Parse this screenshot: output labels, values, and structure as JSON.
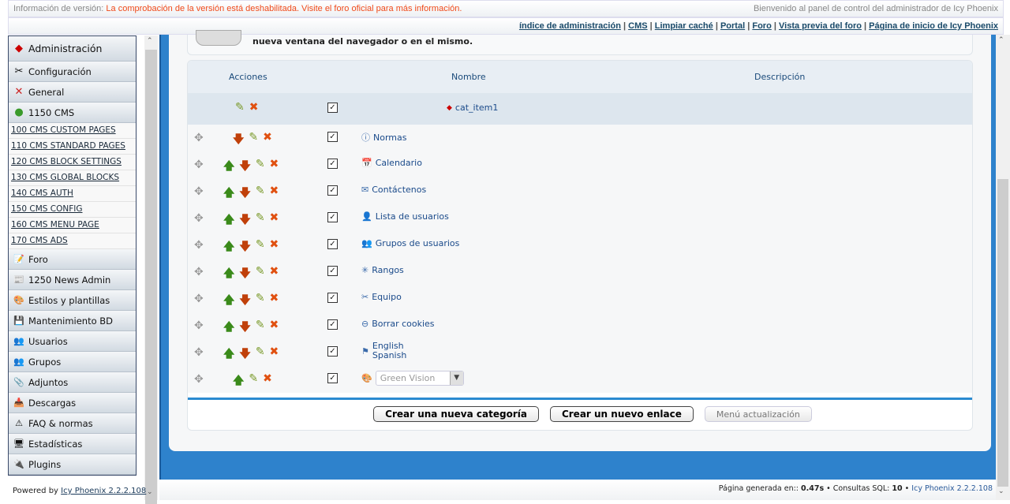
{
  "topbar": {
    "label": "Información de versión:",
    "warning": "La comprobación de la versión está deshabilitada. Visite el foro oficial para más información.",
    "welcome": "Bienvenido al panel de control del administrador de Icy Phoenix"
  },
  "links": [
    "índice de administración",
    "CMS",
    "Limpiar caché",
    "Portal",
    "Foro",
    "Vista previa del foro",
    "Página de inicio de Icy Phoenix"
  ],
  "sidebar": {
    "heads_top": [
      {
        "label": "Administración",
        "icon": "diamond-icon"
      },
      {
        "label": "Configuración",
        "icon": "tools-icon"
      },
      {
        "label": "General",
        "icon": "wrench-icon"
      },
      {
        "label": "1150 CMS",
        "icon": "blocks-icon"
      }
    ],
    "cms_links": [
      "100 CMS CUSTOM PAGES",
      "110 CMS STANDARD PAGES",
      "120 CMS BLOCK SETTINGS",
      "130 CMS GLOBAL BLOCKS",
      "140 CMS AUTH",
      "150 CMS CONFIG",
      "160 CMS MENU PAGE",
      "170 CMS ADS"
    ],
    "heads_bottom": [
      {
        "label": "Foro"
      },
      {
        "label": "1250 News Admin"
      },
      {
        "label": "Estilos y plantillas"
      },
      {
        "label": "Mantenimiento BD"
      },
      {
        "label": "Usuarios"
      },
      {
        "label": "Grupos"
      },
      {
        "label": "Adjuntos"
      },
      {
        "label": "Descargas"
      },
      {
        "label": "FAQ & normas"
      },
      {
        "label": "Estadísticas"
      },
      {
        "label": "Plugins"
      }
    ],
    "powered": "Powered by",
    "powered_link": "Icy Phoenix 2.2.2.108"
  },
  "intro": "nueva ventana del navegador o en el mismo.",
  "table": {
    "headers": {
      "actions": "Acciones",
      "name": "Nombre",
      "description": "Descripción"
    },
    "category": "cat_item1",
    "rows": [
      {
        "name": "Normas",
        "icon": "info-icon"
      },
      {
        "name": "Calendario",
        "icon": "calendar-icon"
      },
      {
        "name": "Contáctenos",
        "icon": "mail-icon"
      },
      {
        "name": "Lista de usuarios",
        "icon": "users-icon"
      },
      {
        "name": "Grupos de usuarios",
        "icon": "groups-icon"
      },
      {
        "name": "Rangos",
        "icon": "star-icon"
      },
      {
        "name": "Equipo",
        "icon": "tools-icon"
      },
      {
        "name": "Borrar cookies",
        "icon": "no-entry-icon"
      },
      {
        "name": "English",
        "name2": "Spanish",
        "icon": "flag-icon"
      },
      {
        "select": "Green Vision",
        "icon": "palette-icon"
      }
    ]
  },
  "buttons": {
    "new_category": "Crear una nueva categoría",
    "new_link": "Crear un nuevo enlace",
    "update_menu": "Menú actualización"
  },
  "footer": {
    "generated": "Página generada en::",
    "time": "0.47s",
    "sql_label": "Consultas SQL:",
    "sql": "10",
    "version": "Icy Phoenix 2.2.2.108"
  }
}
